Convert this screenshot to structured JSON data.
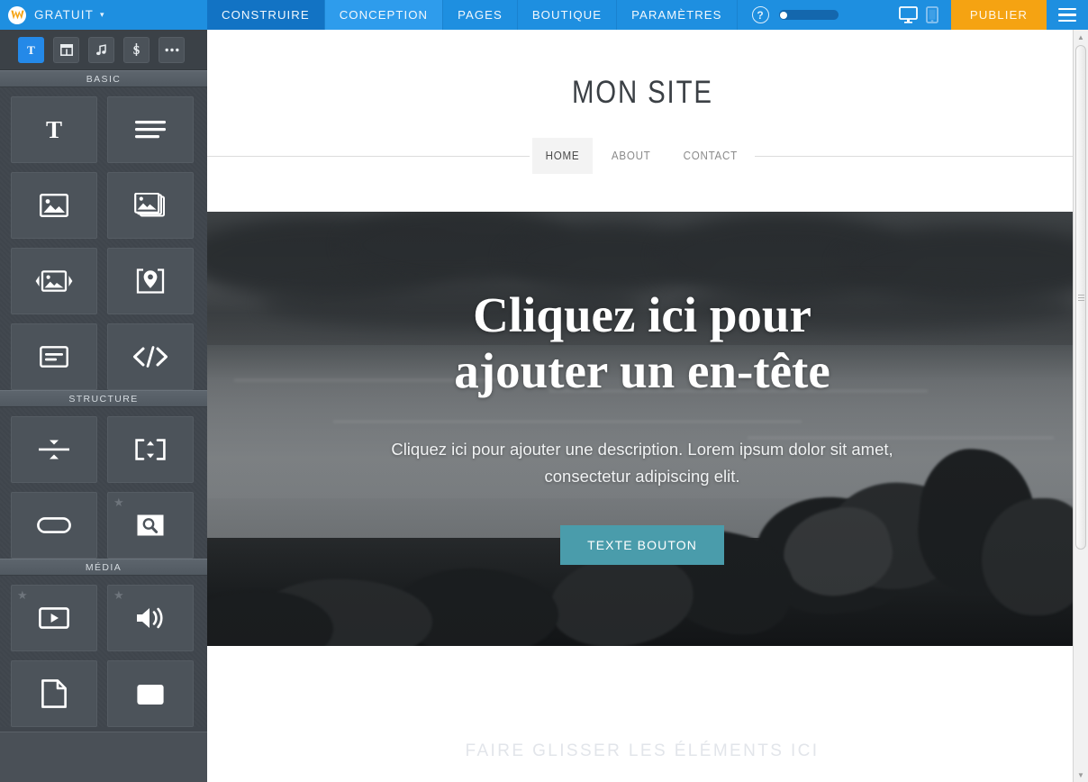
{
  "topbar": {
    "brand_label": "GRATUIT",
    "brand_caret": "▾",
    "logo_icon": "weebly-w-logo-icon",
    "tabs": [
      {
        "label": "CONSTRUIRE",
        "state": "active"
      },
      {
        "label": "CONCEPTION",
        "state": "hover"
      },
      {
        "label": "PAGES",
        "state": "plain"
      },
      {
        "label": "BOUTIQUE",
        "state": "plain"
      },
      {
        "label": "PARAMÈTRES",
        "state": "plain"
      }
    ],
    "help_icon": "question-mark-icon",
    "help_label": "?",
    "progress_percent": 8,
    "device_desktop_icon": "desktop-monitor-icon",
    "device_mobile_icon": "mobile-phone-icon",
    "publish_label": "PUBLIER",
    "menu_icon": "hamburger-menu-icon",
    "accent_blue": "#1e8fe0",
    "accent_blue_active": "#1273c4",
    "accent_orange": "#f5a312"
  },
  "sidebar": {
    "category_tabs": [
      {
        "icon": "text-tool-icon",
        "glyph": "T",
        "active": true
      },
      {
        "icon": "layout-grid-icon",
        "glyph": "",
        "active": false
      },
      {
        "icon": "music-note-icon",
        "glyph": "♫",
        "active": false
      },
      {
        "icon": "dollar-sign-icon",
        "glyph": "S",
        "active": false
      },
      {
        "icon": "more-ellipsis-icon",
        "glyph": "•••",
        "active": false
      }
    ],
    "sections": [
      {
        "title": "BASIC",
        "tiles": [
          {
            "icon": "title-text-icon",
            "premium": false
          },
          {
            "icon": "paragraph-text-icon",
            "premium": false
          },
          {
            "icon": "image-icon",
            "premium": false
          },
          {
            "icon": "gallery-icon",
            "premium": false
          },
          {
            "icon": "slideshow-icon",
            "premium": false
          },
          {
            "icon": "map-pin-icon",
            "premium": false
          },
          {
            "icon": "text-with-image-icon",
            "premium": false
          },
          {
            "icon": "embed-code-icon",
            "premium": false
          }
        ]
      },
      {
        "title": "STRUCTURE",
        "tiles": [
          {
            "icon": "divider-icon",
            "premium": false
          },
          {
            "icon": "spacer-icon",
            "premium": false
          },
          {
            "icon": "button-icon",
            "premium": false
          },
          {
            "icon": "search-box-icon",
            "premium": true
          }
        ]
      },
      {
        "title": "MÉDIA",
        "tiles": [
          {
            "icon": "video-player-icon",
            "premium": true
          },
          {
            "icon": "audio-speaker-icon",
            "premium": true
          },
          {
            "icon": "document-file-icon",
            "premium": false
          },
          {
            "icon": "flash-object-icon",
            "premium": false
          }
        ]
      }
    ],
    "panel_bg": "#40464d"
  },
  "site": {
    "title": "MON SITE",
    "nav": [
      {
        "label": "HOME",
        "active": true
      },
      {
        "label": "ABOUT",
        "active": false
      },
      {
        "label": "CONTACT",
        "active": false
      }
    ],
    "hero": {
      "heading_line1": "Cliquez ici pour",
      "heading_line2": "ajouter un en-tête",
      "description": "Cliquez ici pour ajouter une description. Lorem ipsum dolor sit amet, consectetur adipiscing elit.",
      "button_label": "TEXTE BOUTON",
      "button_color": "#4a9cab",
      "background_image": "grayscale-seascape-rocks-photo"
    },
    "dropzone_label": "FAIRE GLISSER LES ÉLÉMENTS ICI"
  },
  "scrollbar": {
    "up_glyph": "▲",
    "down_glyph": "▼"
  }
}
